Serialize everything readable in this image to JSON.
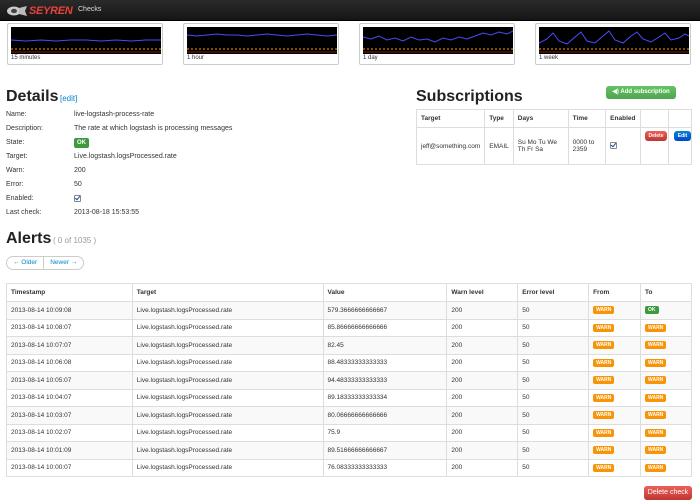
{
  "navbar": {
    "brand": "SEYREN",
    "link": "Checks"
  },
  "graphs": [
    {
      "label": "15 minutes"
    },
    {
      "label": "1 hour"
    },
    {
      "label": "1 day"
    },
    {
      "label": "1 week"
    }
  ],
  "details": {
    "title": "Details",
    "edit": "[edit]",
    "fields": [
      {
        "label": "Name:",
        "value": "live-logstash-process-rate"
      },
      {
        "label": "Description:",
        "value": "The rate at which logstash is processing messages"
      },
      {
        "label": "State:",
        "value": "OK"
      },
      {
        "label": "Target:",
        "value": "Live.logstash.logsProcessed.rate"
      },
      {
        "label": "Warn:",
        "value": "200"
      },
      {
        "label": "Error:",
        "value": "50"
      },
      {
        "label": "Enabled:",
        "value": "checked"
      },
      {
        "label": "Last check:",
        "value": "2013-08-18 15:53:55"
      }
    ]
  },
  "subscriptions": {
    "title": "Subscriptions",
    "add_button": "Add subscription",
    "headers": [
      "Target",
      "Type",
      "Days",
      "Time",
      "Enabled",
      "",
      ""
    ],
    "row": {
      "target": "jeff@something.com",
      "type": "EMAIL",
      "days": "Su Mo Tu We Th Fr Sa",
      "time": "0000 to 2359",
      "delete": "Delete",
      "edit": "Edit"
    }
  },
  "alerts": {
    "title": "Alerts",
    "count": "( 0 of 1035 )",
    "older": "← Older",
    "newer": "Newer →",
    "headers": [
      "Timestamp",
      "Target",
      "Value",
      "Warn level",
      "Error level",
      "From",
      "To"
    ],
    "rows": [
      [
        "2013-08-14 10:09:08",
        "Live.logstash.logsProcessed.rate",
        "579.3666666666667",
        "200",
        "50",
        "WARN",
        "OK"
      ],
      [
        "2013-08-14 10:08:07",
        "Live.logstash.logsProcessed.rate",
        "85.86666666666666",
        "200",
        "50",
        "WARN",
        "WARN"
      ],
      [
        "2013-08-14 10:07:07",
        "Live.logstash.logsProcessed.rate",
        "82.45",
        "200",
        "50",
        "WARN",
        "WARN"
      ],
      [
        "2013-08-14 10:06:08",
        "Live.logstash.logsProcessed.rate",
        "88.48333333333333",
        "200",
        "50",
        "WARN",
        "WARN"
      ],
      [
        "2013-08-14 10:05:07",
        "Live.logstash.logsProcessed.rate",
        "94.48333333333333",
        "200",
        "50",
        "WARN",
        "WARN"
      ],
      [
        "2013-08-14 10:04:07",
        "Live.logstash.logsProcessed.rate",
        "89.18333333333334",
        "200",
        "50",
        "WARN",
        "WARN"
      ],
      [
        "2013-08-14 10:03:07",
        "Live.logstash.logsProcessed.rate",
        "80.06666666666666",
        "200",
        "50",
        "WARN",
        "WARN"
      ],
      [
        "2013-08-14 10:02:07",
        "Live.logstash.logsProcessed.rate",
        "75.9",
        "200",
        "50",
        "WARN",
        "WARN"
      ],
      [
        "2013-08-14 10:01:09",
        "Live.logstash.logsProcessed.rate",
        "89.51666666666667",
        "200",
        "50",
        "WARN",
        "WARN"
      ],
      [
        "2013-08-14 10:00:07",
        "Live.logstash.logsProcessed.rate",
        "76.08333333333333",
        "200",
        "50",
        "WARN",
        "WARN"
      ]
    ]
  },
  "delete_check": "Delete check",
  "colors": {
    "ok": "#3d9a3d",
    "warn": "#f89406",
    "danger": "#bd362f",
    "success": "#51a351",
    "primary": "#0044cc",
    "graph_line": "#3a3ad0",
    "graph_threshold": "#f0a000"
  }
}
